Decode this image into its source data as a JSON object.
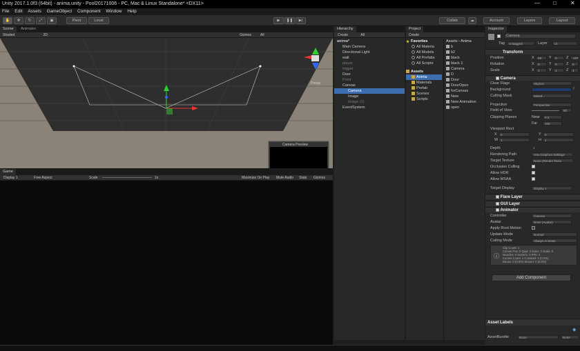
{
  "window": {
    "title": "Unity 2017.1.0f3 (64bit) - anima.unity - Pool20171006 - PC, Mac & Linux Standalone* <DX11>",
    "min": "—",
    "max": "□",
    "close": "✕"
  },
  "menu": [
    "File",
    "Edit",
    "Assets",
    "GameObject",
    "Component",
    "Window",
    "Help"
  ],
  "toolbar": {
    "pivot": "Pivot",
    "local": "Local",
    "collab": "Collab",
    "account": "Account",
    "layers": "Layers",
    "layout": "Layout"
  },
  "scene": {
    "tabs": [
      "Scene",
      "Animator"
    ],
    "shaded": "Shaded",
    "mode2d": "2D",
    "gizmos": "Gizmos",
    "search": "All",
    "persp": "Persp",
    "camera_preview": "Camera Preview"
  },
  "game": {
    "tab": "Game",
    "display": "Display 1",
    "aspect": "Free Aspect",
    "scale": "Scale",
    "scale_val": "1x",
    "max": "Maximize On Play",
    "mute": "Mute Audio",
    "stats": "Stats",
    "gizmos": "Gizmos"
  },
  "hierarchy": {
    "tab": "Hierarchy",
    "create": "Create",
    "search": "All",
    "items": [
      {
        "label": "anima*",
        "indent": 0,
        "state": "scene"
      },
      {
        "label": "Main Camera",
        "indent": 1,
        "state": "normal"
      },
      {
        "label": "Directional Light",
        "indent": 1,
        "state": "normal"
      },
      {
        "label": "wall",
        "indent": 1,
        "state": "normal"
      },
      {
        "label": "player",
        "indent": 1,
        "state": "dim"
      },
      {
        "label": "trigger",
        "indent": 1,
        "state": "dim"
      },
      {
        "label": "Door",
        "indent": 1,
        "state": "normal"
      },
      {
        "label": "Point",
        "indent": 1,
        "state": "dim"
      },
      {
        "label": "Canvas",
        "indent": 1,
        "state": "normal"
      },
      {
        "label": "Camera",
        "indent": 2,
        "state": "selected"
      },
      {
        "label": "Image",
        "indent": 2,
        "state": "normal"
      },
      {
        "label": "Image (1)",
        "indent": 2,
        "state": "dim"
      },
      {
        "label": "EventSystem",
        "indent": 1,
        "state": "normal"
      }
    ]
  },
  "project": {
    "tab": "Project",
    "create": "Create",
    "breadcrumb": "Assets › Anima",
    "favorites_label": "Favorites",
    "favorites": [
      "All Materia",
      "All Models",
      "All Prefabs",
      "All Scripts"
    ],
    "assets_label": "Assets",
    "folders": [
      "Anima",
      "Materials",
      "Prefab",
      "Scenes",
      "Scripts"
    ],
    "files": [
      "b",
      "b2",
      "black",
      "black 1",
      "Camera",
      "D",
      "Door",
      "DoorOpen",
      "forCanvas",
      "New",
      "New Animation",
      "open"
    ]
  },
  "inspector": {
    "tab": "Inspector",
    "object_name": "Camera",
    "tag_label": "Tag",
    "tag": "Untagged",
    "layer_label": "Layer",
    "layer": "UI",
    "transform": {
      "title": "Transform",
      "position": {
        "label": "Position",
        "x": "59",
        "y": "0",
        "z": "-157"
      },
      "rotation": {
        "label": "Rotation",
        "x": "0",
        "y": "0",
        "z": "0"
      },
      "scale": {
        "label": "Scale",
        "x": "1",
        "y": "1",
        "z": "1"
      }
    },
    "camera": {
      "title": "Camera",
      "clear_flags": {
        "label": "Clear Flags",
        "value": "Skybox"
      },
      "background": {
        "label": "Background"
      },
      "culling_mask": {
        "label": "Culling Mask",
        "value": "Mixed..."
      },
      "projection": {
        "label": "Projection",
        "value": "Perspective"
      },
      "fov": {
        "label": "Field of View",
        "value": "60"
      },
      "clipping": {
        "label": "Clipping Planes",
        "near_label": "Near",
        "near": "0.3",
        "far_label": "Far",
        "far": "100"
      },
      "viewport": {
        "label": "Viewport Rect",
        "x": "0",
        "y": "0",
        "w": "1",
        "h": "1"
      },
      "depth": {
        "label": "Depth",
        "value": "1"
      },
      "rendering_path": {
        "label": "Rendering Path",
        "value": "Use Graphics Settings"
      },
      "target_texture": {
        "label": "Target Texture",
        "value": "None (Render Textu"
      },
      "occlusion": {
        "label": "Occlusion Culling"
      },
      "hdr": {
        "label": "Allow HDR"
      },
      "msaa": {
        "label": "Allow MSAA"
      },
      "target_display": {
        "label": "Target Display",
        "value": "Display 1"
      }
    },
    "flare_layer": "Flare Layer",
    "gui_layer": "GUI Layer",
    "animator": {
      "title": "Animator",
      "controller": {
        "label": "Controller",
        "value": "Camera"
      },
      "avatar": {
        "label": "Avatar",
        "value": "None (Avatar)"
      },
      "root_motion": {
        "label": "Apply Root Motion"
      },
      "update_mode": {
        "label": "Update Mode",
        "value": "Normal"
      },
      "culling_mode": {
        "label": "Culling Mode",
        "value": "Always Animate"
      },
      "info": [
        "Clip Count: 1",
        "Curves Pos: 0 Quat: 0 Euler: 0 Scale: 0",
        "Muscles: 0 Generic: 0 PPtr: 0",
        "Curves Count: 1 Constant: 0 (0.0%)",
        "Dense: 0 (0.0%) Stream: 0 (0.0%)"
      ]
    },
    "add_component": "Add Component",
    "asset_labels": "Asset Labels",
    "asset_bundle": {
      "label": "AssetBundle",
      "value": "None",
      "variant": "None"
    }
  }
}
